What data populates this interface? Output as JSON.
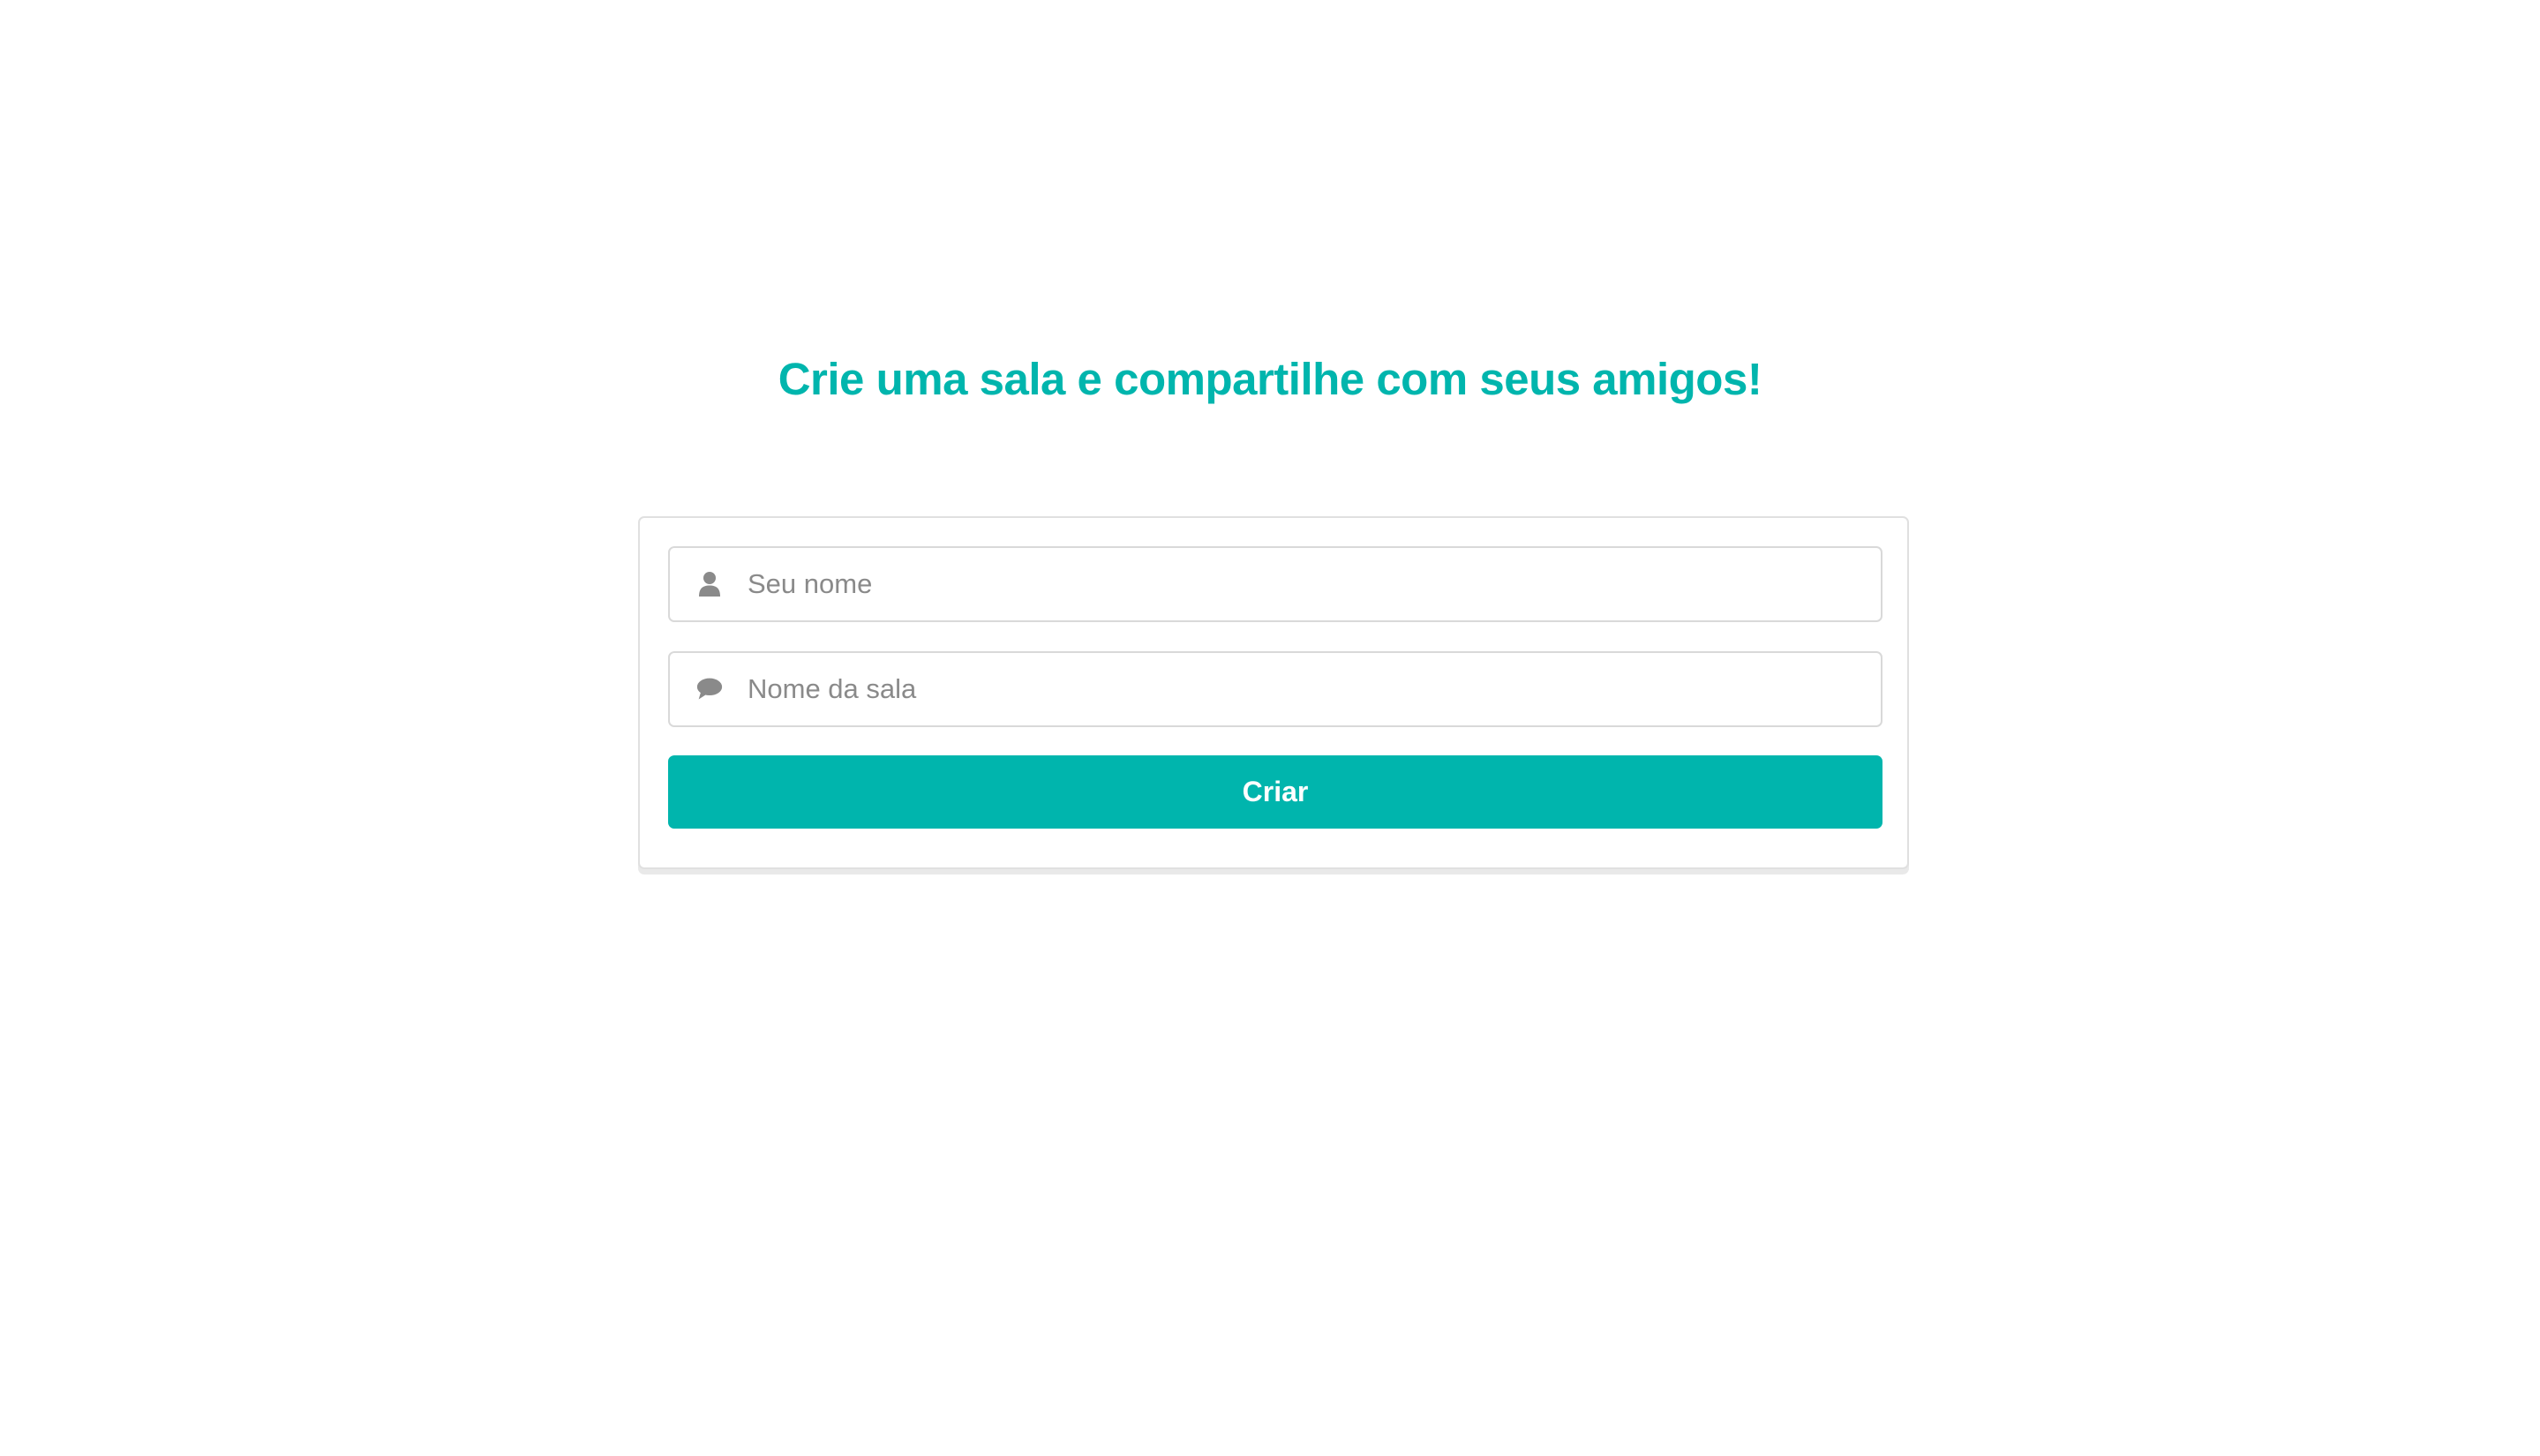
{
  "page": {
    "title": "Crie uma sala e compartilhe com seus amigos!"
  },
  "form": {
    "name_field": {
      "placeholder": "Seu nome",
      "value": "",
      "icon": "user-icon"
    },
    "room_field": {
      "placeholder": "Nome da sala",
      "value": "",
      "icon": "comment-icon"
    },
    "submit_label": "Criar"
  },
  "colors": {
    "accent": "#00b5ad",
    "icon": "#8a8a8a",
    "border": "#d9d9d9",
    "background": "#ffffff"
  }
}
